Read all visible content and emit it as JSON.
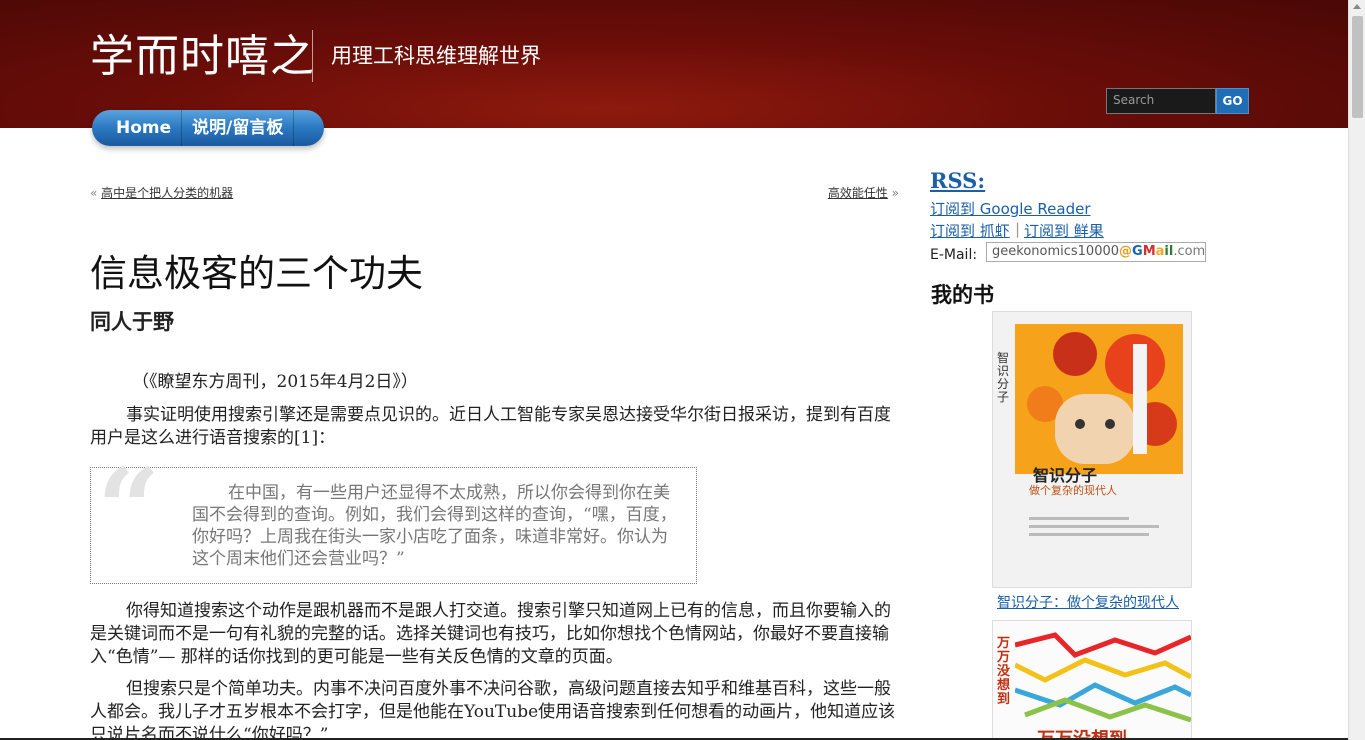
{
  "header": {
    "site_title": "学而时嘻之",
    "tagline": "用理工科思维理解世界",
    "search_placeholder": "Search",
    "search_button": "GO"
  },
  "nav": {
    "items": [
      {
        "label": "Home"
      },
      {
        "label": "说明/留言板"
      }
    ]
  },
  "post_nav": {
    "prev_arrow": "«",
    "prev_label": "高中是个把人分类的机器",
    "next_label": "高效能任性",
    "next_arrow": "»"
  },
  "post": {
    "title": "信息极客的三个功夫",
    "author": "同人于野",
    "source": "（《瞭望东方周刊，2015年4月2日》）",
    "paragraph1": "事实证明使用搜索引擎还是需要点见识的。近日人工智能专家吴恩达接受华尔街日报采访，提到有百度用户是这么进行语音搜索的[1]：",
    "quote_mark": "“",
    "quote": "在中国，有一些用户还显得不太成熟，所以你会得到你在美国不会得到的查询。例如，我们会得到这样的查询，“嘿，百度，你好吗？上周我在街头一家小店吃了面条，味道非常好。你认为这个周末他们还会营业吗？”",
    "paragraph2": "你得知道搜索这个动作是跟机器而不是跟人打交道。搜索引擎只知道网上已有的信息，而且你要输入的是关键词而不是一句有礼貌的完整的话。选择关键词也有技巧，比如你想找个色情网站，你最好不要直接输入“色情”— 那样的话你找到的更可能是一些有关反色情的文章的页面。",
    "paragraph3": "但搜索只是个简单功夫。内事不决问百度外事不决问谷歌，高级问题直接去知乎和维基百科，这些一般人都会。我儿子才五岁根本不会打字，但是他能在YouTube使用语音搜索到任何想看的动画片，他知道应该只说片名而不说什么“你好吗？”"
  },
  "sidebar": {
    "rss_title": "RSS:",
    "subscribe_google": "订阅到 Google Reader",
    "subscribe_zhuaxia": "订阅到 抓虾",
    "subscribe_sep": "|",
    "subscribe_xianguo": "订阅到 鲜果",
    "email_label": "E-Mail:",
    "email_user": "geekonomics10000",
    "email_at": "@",
    "email_g": "G",
    "email_m": "M",
    "email_a": "a",
    "email_il": "il",
    "email_com": ".com",
    "books_title": "我的书",
    "book1": {
      "spine": "智识分子",
      "cover_title": "智识分子",
      "cover_sub": "做个复杂的现代人",
      "caption": "智识分子：做个复杂的现代人"
    },
    "book2": {
      "spine": "万万没想到",
      "cover_title": "万万没想到"
    }
  },
  "colors": {
    "header_red": "#6a0d08",
    "link_blue": "#1a5fa8",
    "nav_blue": "#2a78c2"
  }
}
